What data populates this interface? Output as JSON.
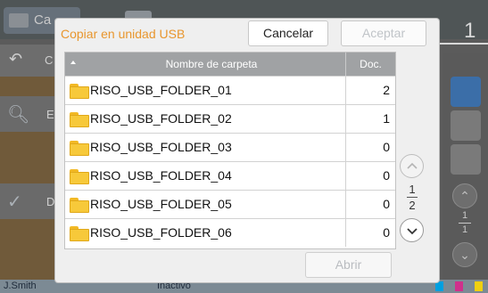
{
  "background": {
    "card_title": "Ca",
    "toolbar_letter": "C",
    "list_letters": [
      "E",
      "D"
    ],
    "page_indicator": "1",
    "page_fraction": {
      "current": "1",
      "total": "1"
    },
    "status": {
      "user": "J.Smith",
      "state": "Inactivo"
    },
    "colors": {
      "panel": "#705a3a",
      "status_bar": "#7c8a94"
    }
  },
  "dialog": {
    "title": "Copiar en unidad USB",
    "cancel_label": "Cancelar",
    "accept_label": "Aceptar",
    "table": {
      "columns": [
        "Nombre de carpeta",
        "Doc."
      ],
      "rows": [
        {
          "name": "RISO_USB_FOLDER_01",
          "docs": "2"
        },
        {
          "name": "RISO_USB_FOLDER_02",
          "docs": "1"
        },
        {
          "name": "RISO_USB_FOLDER_03",
          "docs": "0"
        },
        {
          "name": "RISO_USB_FOLDER_04",
          "docs": "0"
        },
        {
          "name": "RISO_USB_FOLDER_05",
          "docs": "0"
        },
        {
          "name": "RISO_USB_FOLDER_06",
          "docs": "0"
        }
      ]
    },
    "pagination": {
      "current": "1",
      "total": "2"
    },
    "open_label": "Abrir",
    "colors": {
      "title": "#e8962e",
      "header": "#a0a2a4",
      "folder": "#f7c93a"
    }
  }
}
